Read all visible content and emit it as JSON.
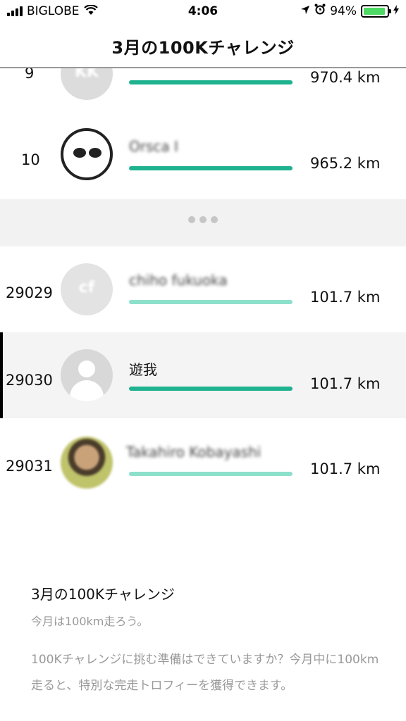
{
  "status_bar": {
    "carrier": "BIGLOBE",
    "time": "4:06",
    "battery_percent": "94%",
    "battery_level": 0.94,
    "battery_color": "#4cd964"
  },
  "header": {
    "title": "3月の100Kチャレンジ"
  },
  "leaderboard": {
    "bar_color": "#1fb28f",
    "bar_color_light": "#8de0cc",
    "rows": [
      {
        "rank": "9",
        "name": "",
        "avatar_initials": "KK",
        "distance": "970.4 km",
        "progress": 1.0
      },
      {
        "rank": "10",
        "name": "Orsca I",
        "distance": "965.2 km",
        "progress": 1.0
      },
      {
        "rank": "29029",
        "name": "chiho fukuoka",
        "avatar_initials": "cf",
        "distance": "101.7 km",
        "progress": 1.0
      },
      {
        "rank": "29030",
        "name": "遊我",
        "distance": "101.7 km",
        "progress": 1.0
      },
      {
        "rank": "29031",
        "name": "Takahiro Kobayashi",
        "distance": "101.7 km",
        "progress": 1.0
      }
    ]
  },
  "description": {
    "title": "3月の100Kチャレンジ",
    "subtitle": "今月は100km走ろう。",
    "body": "100Kチャレンジに挑む準備はできていますか？今月中に100km走ると、特別な完走トロフィーを獲得できます。"
  }
}
